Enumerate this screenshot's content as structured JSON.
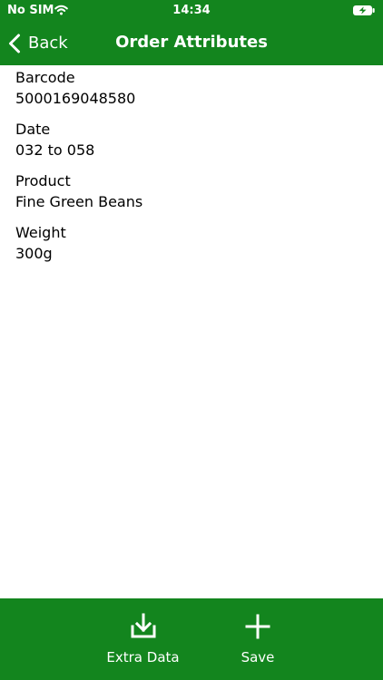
{
  "status_bar": {
    "carrier": "No SIM",
    "time": "14:34",
    "wifi_icon": "wifi-icon",
    "battery_icon": "battery-charging-icon"
  },
  "navigation": {
    "back_label": "Back",
    "back_icon": "chevron-left-icon",
    "title": "Order Attributes"
  },
  "attributes": [
    {
      "label": "Barcode",
      "value": "5000169048580"
    },
    {
      "label": "Date",
      "value": "032 to 058"
    },
    {
      "label": "Product",
      "value": "Fine Green Beans"
    },
    {
      "label": "Weight",
      "value": "300g"
    }
  ],
  "toolbar": {
    "extra_data_label": "Extra Data",
    "extra_data_icon": "download-icon",
    "save_label": "Save",
    "save_icon": "plus-icon"
  },
  "colors": {
    "brand_green": "#13851e",
    "text": "#000000",
    "background": "#ffffff",
    "on_brand_text": "#ffffff"
  }
}
